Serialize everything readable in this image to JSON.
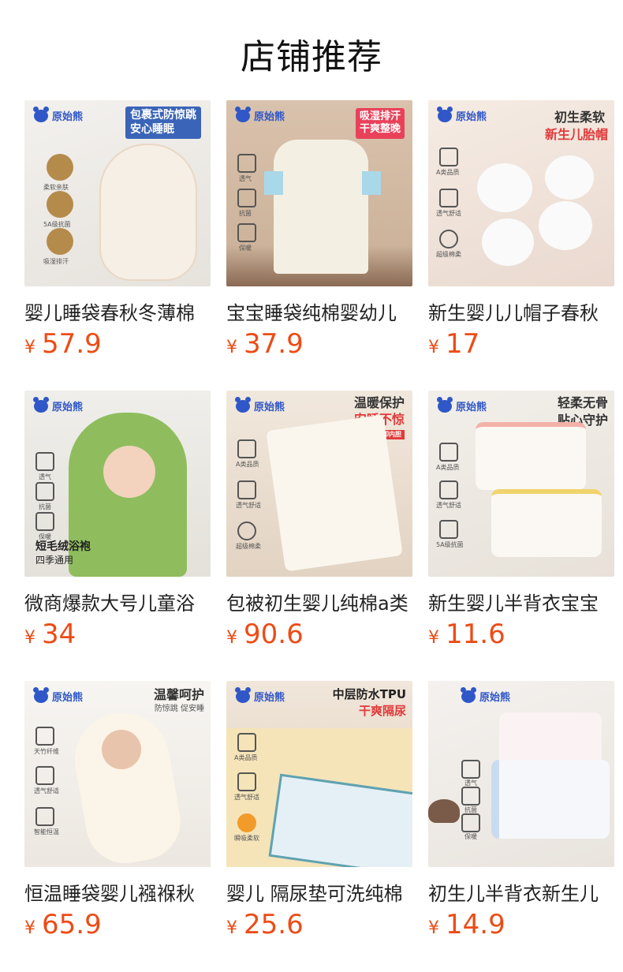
{
  "page": {
    "title": "店铺推荐"
  },
  "brand": {
    "name": "原始熊"
  },
  "products": [
    {
      "name": "婴儿睡袋春秋冬薄棉",
      "currency": "¥",
      "price": "57.9",
      "tag_lines": [
        "包裹式防惊跳",
        "安心睡眠"
      ],
      "features": [
        "柔软亲肤",
        "5A级抗菌",
        "吸湿排汗"
      ]
    },
    {
      "name": "宝宝睡袋纯棉婴幼儿",
      "currency": "¥",
      "price": "37.9",
      "tag_lines": [
        "吸湿排汗",
        "干爽整晚"
      ],
      "features": [
        "透气",
        "抗菌",
        "保暖"
      ]
    },
    {
      "name": "新生婴儿儿帽子春秋",
      "currency": "¥",
      "price": "17",
      "tag_lines": [
        "初生柔软",
        "新生儿胎帽"
      ],
      "features": [
        "A类品质",
        "透气舒适",
        "超级棉柔"
      ]
    },
    {
      "name": "微商爆款大号儿童浴",
      "currency": "¥",
      "price": "34",
      "tag_lines": [
        "短毛绒浴袍",
        "四季通用"
      ],
      "features": [
        "透气",
        "抗菌",
        "保暖"
      ]
    },
    {
      "name": "包被初生婴儿纯棉a类",
      "currency": "¥",
      "price": "90.6",
      "tag_lines": [
        "温暖保护",
        "安睡不惊",
        "可拆卸内胆"
      ],
      "features": [
        "A类品质",
        "透气舒适",
        "超级棉柔"
      ]
    },
    {
      "name": "新生婴儿半背衣宝宝",
      "currency": "¥",
      "price": "11.6",
      "tag_lines": [
        "轻柔无骨",
        "贴心守护"
      ],
      "features": [
        "A类品质",
        "透气舒适",
        "5A级抗菌"
      ]
    },
    {
      "name": "恒温睡袋婴儿襁褓秋",
      "currency": "¥",
      "price": "65.9",
      "tag_lines": [
        "温馨呵护",
        "防惊跳 促安睡"
      ],
      "features": [
        "天竹纤维",
        "透气舒适",
        "智能恒温"
      ]
    },
    {
      "name": "婴儿 隔尿垫可洗纯棉",
      "currency": "¥",
      "price": "25.6",
      "tag_lines": [
        "中层防水TPU",
        "干爽隔尿"
      ],
      "features": [
        "A类品质",
        "透气舒适",
        "瞬吸柔软"
      ]
    },
    {
      "name": "初生儿半背衣新生儿",
      "currency": "¥",
      "price": "14.9",
      "tag_lines": [],
      "features": [
        "透气",
        "抗菌",
        "保暖"
      ]
    }
  ],
  "colors": {
    "price": "#ec4c16",
    "brand": "#2f57c8"
  }
}
